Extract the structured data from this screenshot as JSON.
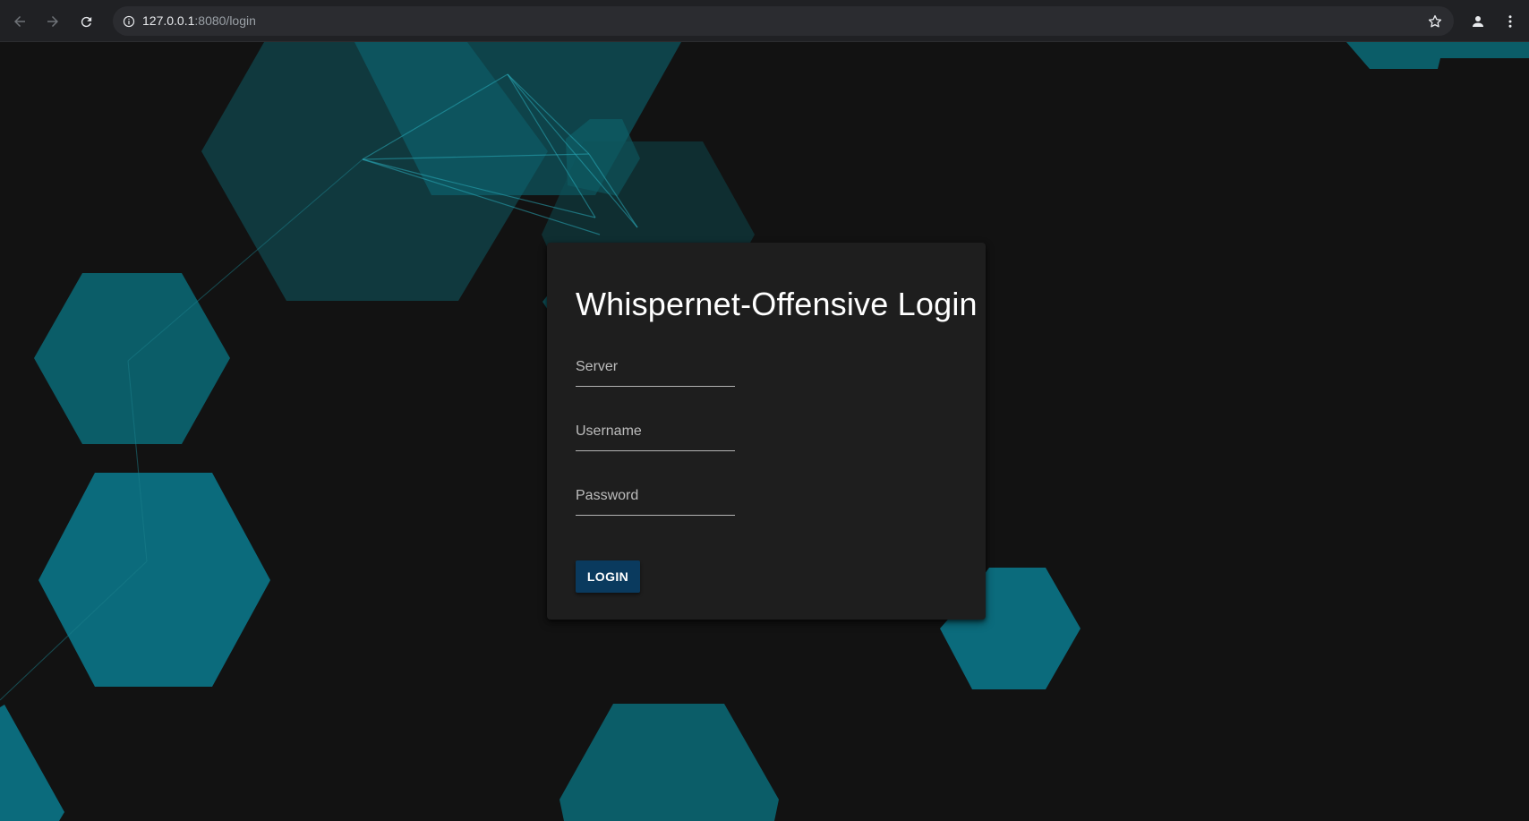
{
  "browser": {
    "url_host": "127.0.0.1",
    "url_path": ":8080/login",
    "icons": {
      "back": "arrow-left-icon",
      "forward": "arrow-right-icon",
      "reload": "reload-icon",
      "site_info": "info-circle-icon",
      "bookmark": "star-outline-icon",
      "profile": "person-icon",
      "menu": "vertical-dots-icon"
    }
  },
  "login": {
    "title": "Whispernet-Offensive Login",
    "server_placeholder": "Server",
    "username_placeholder": "Username",
    "password_placeholder": "Password",
    "button_label": "LOGIN"
  },
  "colors": {
    "background": "#121212",
    "card": "#1e1e1e",
    "accent_hex": "#0b7688",
    "button": "#0a3a5e"
  }
}
